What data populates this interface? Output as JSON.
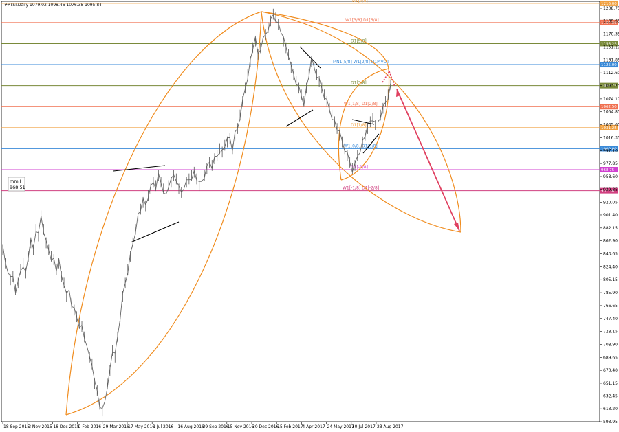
{
  "chart_data": {
    "type": "line",
    "title": "#RTSI,Daily 1079.02 1098.46 1076.38 1095.84",
    "ylim": [
      593.95,
      1219.0
    ],
    "y_ticks": [
      1208.75,
      1189.65,
      1170.35,
      1151.1,
      1131.85,
      1112.6,
      1093.75,
      1074.1,
      1054.85,
      1035.6,
      1016.35,
      997.1,
      977.85,
      958.6,
      939.35,
      920.05,
      901.4,
      882.15,
      862.9,
      843.65,
      824.4,
      805.15,
      785.9,
      766.65,
      747.4,
      728.15,
      708.9,
      689.65,
      670.4,
      651.15,
      632.45,
      613.2,
      593.95
    ],
    "x_labels": [
      "18 Sep 2015",
      "3 Nov 2015",
      "18 Dec 2015",
      "9 Feb 2016",
      "29 Mar 2016",
      "17 May 2016",
      "1 Jul 2016",
      "16 Aug 2016",
      "29 Sep 2016",
      "15 Nov 2016",
      "30 Dec 2016",
      "15 Feb 2017",
      "4 Apr 2017",
      "24 May 2017",
      "10 Jul 2017",
      "23 Aug 2017"
    ],
    "series": [
      {
        "values": [
          850,
          830,
          820,
          805,
          810,
          790,
          800,
          820,
          830,
          815,
          840,
          860,
          850,
          880,
          870,
          900,
          880,
          860,
          850,
          840,
          835,
          820,
          830,
          810,
          800,
          780,
          790,
          770,
          760,
          750,
          740,
          735,
          720,
          700,
          690,
          680,
          650,
          640,
          620,
          610,
          625,
          650,
          670,
          700,
          690,
          720,
          750,
          780,
          800,
          820,
          840,
          860,
          880,
          900,
          910,
          920,
          915,
          930,
          940,
          950,
          945,
          960,
          950,
          940,
          930,
          945,
          950,
          960,
          955,
          940,
          935,
          945,
          950,
          955,
          960,
          965,
          955,
          945,
          950,
          960,
          970,
          980,
          975,
          985,
          990,
          1000,
          995,
          1005,
          1010,
          1015,
          1000,
          1020,
          1030,
          1050,
          1070,
          1090,
          1110,
          1130,
          1150,
          1160,
          1140,
          1150,
          1160,
          1170,
          1180,
          1190,
          1200,
          1195,
          1185,
          1175,
          1160,
          1150,
          1140,
          1120,
          1110,
          1100,
          1090,
          1080,
          1070,
          1090,
          1110,
          1130,
          1120,
          1110,
          1100,
          1090,
          1080,
          1070,
          1060,
          1050,
          1040,
          1030,
          1020,
          1010,
          1000,
          990,
          980,
          970,
          975,
          990,
          1000,
          1010,
          1020,
          1030,
          1040,
          1045,
          1035,
          1040,
          1050,
          1060,
          1070,
          1080,
          1095
        ]
      }
    ],
    "levels": [
      {
        "label": "D1[7/8]",
        "price": 1216.0,
        "color": "#f0a040"
      },
      {
        "label": "W1[3/8] D1[6/8]",
        "price": 1187.5,
        "color": "#f07050"
      },
      {
        "label": "D1[5/8]",
        "price": 1156.25,
        "color": "#7a8a3a"
      },
      {
        "label": "MN1[5/8] W1[2/8] D1PIVOT",
        "price": 1125.0,
        "color": "#3a8ad8"
      },
      {
        "label": "D1[3/8]",
        "price": 1093.75,
        "color": "#7a8a3a"
      },
      {
        "label": "W1[1/8] D1[2/8]",
        "price": 1062.5,
        "color": "#f07050"
      },
      {
        "label": "D1[1/8]",
        "price": 1031.25,
        "color": "#f0a040"
      },
      {
        "label": "W1[0/8] D1[0/8]",
        "price": 1000.0,
        "color": "#3a8ad8"
      },
      {
        "label": "D1[-1/8]",
        "price": 968.75,
        "color": "#d040d0"
      },
      {
        "label": "W1[-1/8] D1[-2/8]",
        "price": 937.5,
        "color": "#d04080"
      }
    ],
    "price_tags": [
      "1216.00",
      "1187.50",
      "1156.25",
      "1125.00",
      "1093.75",
      "1062.50",
      "1031.25",
      "1000.00",
      "968.75",
      "937.50"
    ],
    "indicator": {
      "name": "mmlI",
      "value": "968.51"
    },
    "arcs_color": "#f08c1e",
    "arrow_color": "#e04060",
    "grid": false
  }
}
